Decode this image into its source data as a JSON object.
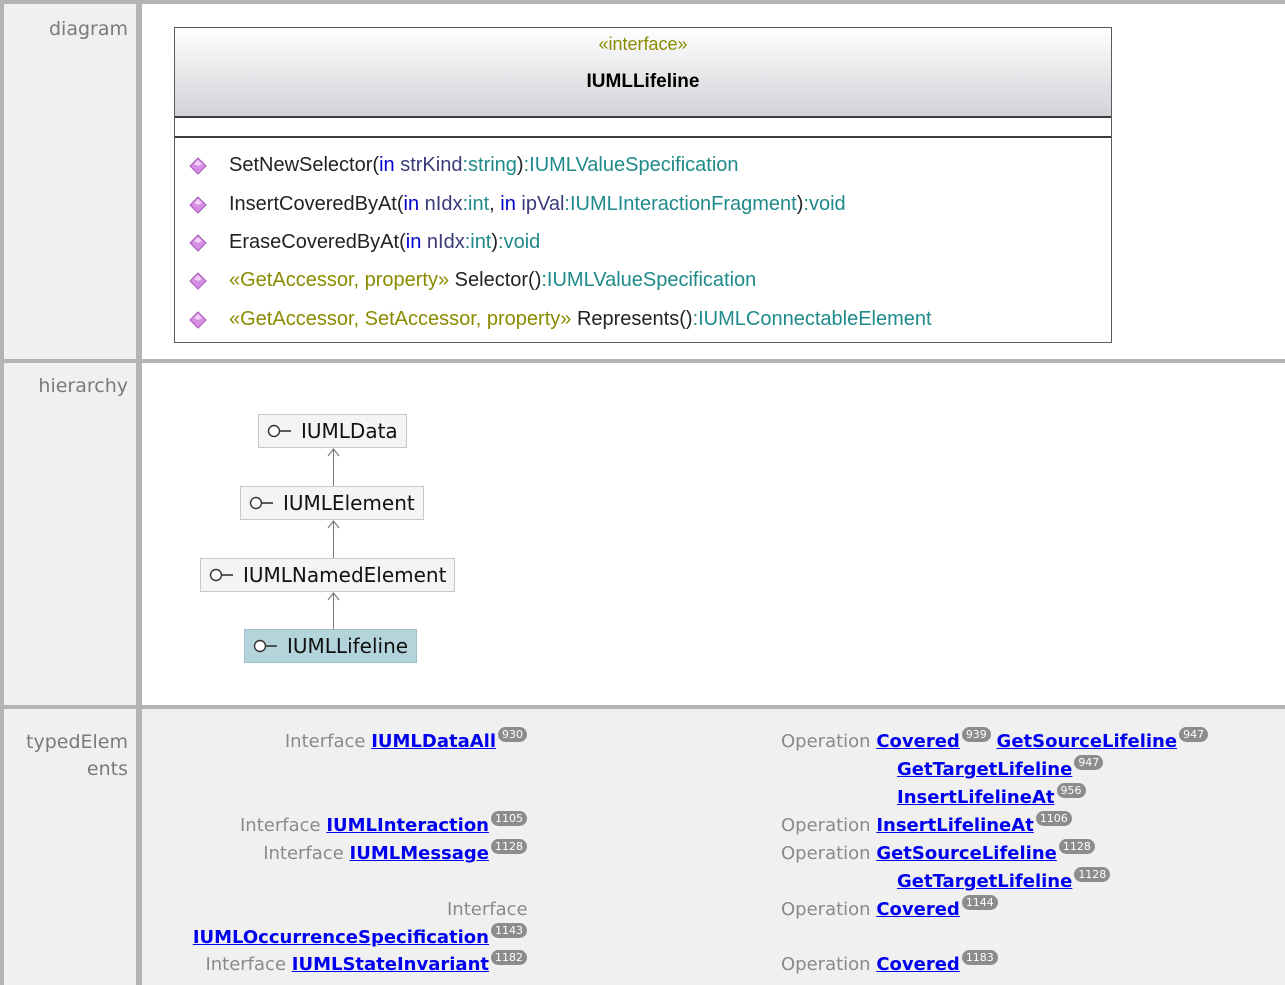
{
  "rows": {
    "diagram_label": "diagram",
    "hierarchy_label": "hierarchy",
    "typed_label_1": "typedElem",
    "typed_label_2": "ents"
  },
  "uml": {
    "stereotype": "«interface»",
    "name": "IUMLLifeline",
    "ops": [
      {
        "pre": "",
        "name": "SetNewSelector(",
        "p1kw": "in",
        "p1": " strKind",
        "p1type": ":string",
        "close": ")",
        "ret": ":IUMLValueSpecification",
        "extra": ""
      },
      {
        "pre": "",
        "name": "InsertCoveredByAt(",
        "p1kw": "in",
        "p1": " nIdx",
        "p1type": ":int",
        "sep": ", ",
        "p2kw": "in",
        "p2": " ipVal",
        "p2type": ":IUMLInteractionFragment",
        "close": ")",
        "ret": ":void"
      },
      {
        "pre": "",
        "name": "EraseCoveredByAt(",
        "p1kw": "in",
        "p1": " nIdx",
        "p1type": ":int",
        "close": ")",
        "ret": ":void"
      },
      {
        "pre": "«GetAccessor, property» ",
        "name": "Selector()",
        "ret": ":IUMLValueSpecification"
      },
      {
        "pre": "«GetAccessor, SetAccessor, property» ",
        "name": "Represents()",
        "ret": ":IUMLConnectableElement"
      }
    ],
    "colors": {
      "stereotype": "#8b8b00",
      "keyword": "#0000cc",
      "type": "#1f8a8a",
      "icon": "#c878d8"
    }
  },
  "hierarchy": [
    "IUMLData",
    "IUMLElement",
    "IUMLNamedElement",
    "IUMLLifeline"
  ],
  "typed": {
    "left": [
      {
        "kind": "Interface",
        "name": "IUMLDataAll",
        "badge": "930"
      },
      {
        "kind": "Interface",
        "name": "IUMLInteraction",
        "badge": "1105"
      },
      {
        "kind": "Interface",
        "name": "IUMLMessage",
        "badge": "1128"
      },
      {
        "kind": "Interface",
        "name": "IUMLOccurrenceSpecification",
        "badge": "1143"
      },
      {
        "kind": "Interface",
        "name": "IUMLStateInvariant",
        "badge": "1182"
      }
    ],
    "right": [
      {
        "kind": "Operation",
        "items": [
          {
            "name": "Covered",
            "badge": "939"
          },
          {
            "name": "GetSourceLifeline",
            "badge": "947"
          },
          {
            "name": "GetTargetLifeline",
            "badge": "947"
          },
          {
            "name": "InsertLifelineAt",
            "badge": "956"
          }
        ]
      },
      {
        "kind": "Operation",
        "items": [
          {
            "name": "InsertLifelineAt",
            "badge": "1106"
          }
        ]
      },
      {
        "kind": "Operation",
        "items": [
          {
            "name": "GetSourceLifeline",
            "badge": "1128"
          },
          {
            "name": "GetTargetLifeline",
            "badge": "1128"
          }
        ]
      },
      {
        "kind": "Operation",
        "items": [
          {
            "name": "Covered",
            "badge": "1144"
          }
        ]
      },
      {
        "kind": "Operation",
        "items": [
          {
            "name": "Covered",
            "badge": "1183"
          }
        ]
      }
    ]
  }
}
